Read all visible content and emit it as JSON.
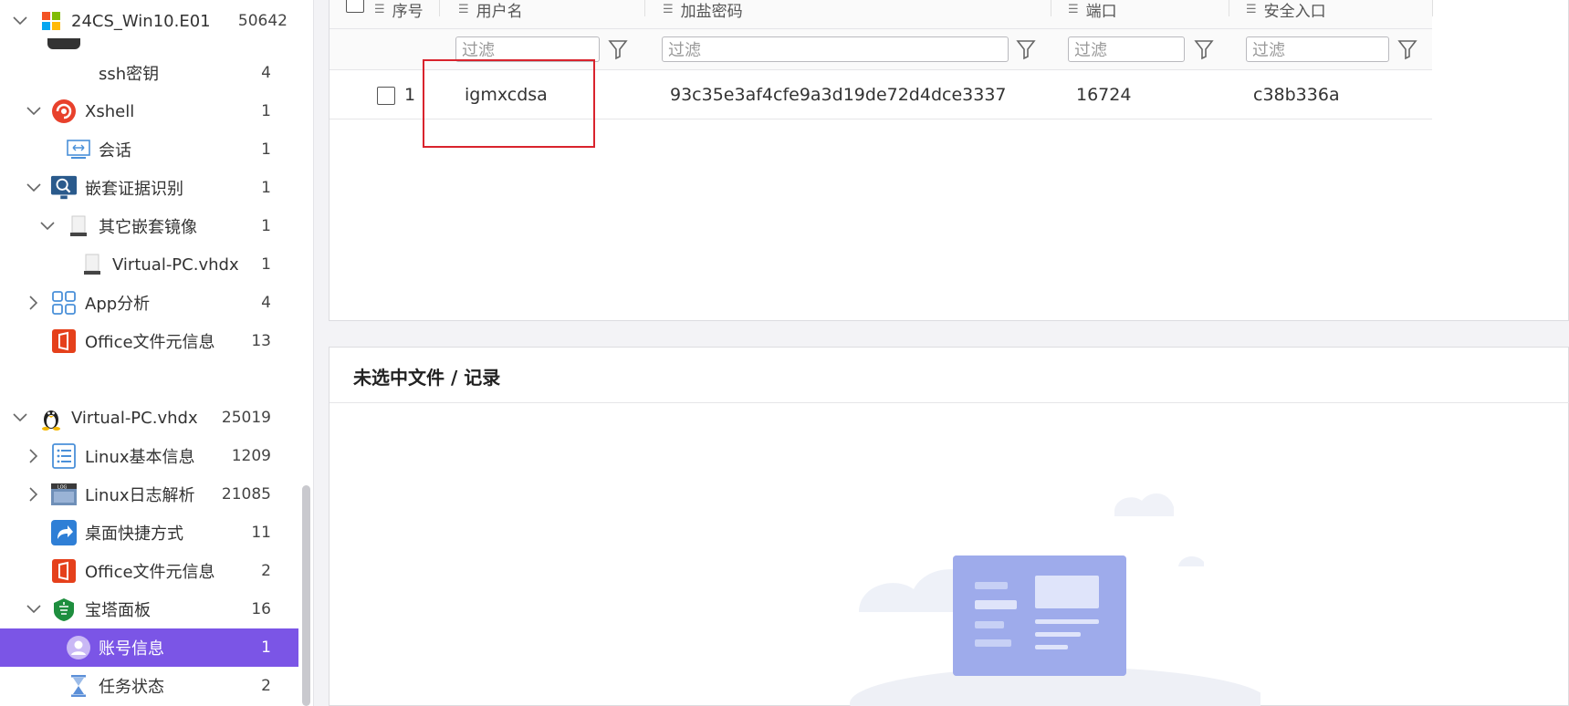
{
  "sidebar": {
    "items": [
      {
        "label": "24CS_Win10.E01",
        "count": "50642",
        "icon": "windows-icon"
      },
      {
        "label": "ssh密钥",
        "count": "4",
        "icon": ""
      },
      {
        "label": "Xshell",
        "count": "1",
        "icon": "xshell-icon"
      },
      {
        "label": "会话",
        "count": "1",
        "icon": "session-icon"
      },
      {
        "label": "嵌套证据识别",
        "count": "1",
        "icon": "nested-evidence-icon"
      },
      {
        "label": "其它嵌套镜像",
        "count": "1",
        "icon": "disk-icon"
      },
      {
        "label": "Virtual-PC.vhdx",
        "count": "1",
        "icon": "disk-icon"
      },
      {
        "label": "App分析",
        "count": "4",
        "icon": "app-grid-icon"
      },
      {
        "label": "Office文件元信息",
        "count": "13",
        "icon": "office-icon"
      },
      {
        "label": "Virtual-PC.vhdx",
        "count": "25019",
        "icon": "linux-icon"
      },
      {
        "label": "Linux基本信息",
        "count": "1209",
        "icon": "list-icon"
      },
      {
        "label": "Linux日志解析",
        "count": "21085",
        "icon": "log-icon"
      },
      {
        "label": "桌面快捷方式",
        "count": "11",
        "icon": "shortcut-icon"
      },
      {
        "label": "Office文件元信息",
        "count": "2",
        "icon": "office-icon"
      },
      {
        "label": "宝塔面板",
        "count": "16",
        "icon": "baota-icon"
      },
      {
        "label": "账号信息",
        "count": "1",
        "icon": "user-icon"
      },
      {
        "label": "任务状态",
        "count": "2",
        "icon": "hourglass-icon"
      }
    ]
  },
  "table": {
    "columns": [
      "序号",
      "用户名",
      "加盐密码",
      "端口",
      "安全入口"
    ],
    "filter_placeholder": "过滤",
    "rows": [
      {
        "index": "1",
        "username": "igmxcdsa",
        "salted_password": "93c35e3af4cfe9a3d19de72d4dce3337",
        "port": "16724",
        "security_entry": "c38b336a"
      }
    ]
  },
  "detail": {
    "title": "未选中文件 / 记录"
  },
  "colors": {
    "selected": "#7b55e6",
    "highlight": "#d9232d",
    "illustration": "#8f9ee6"
  }
}
